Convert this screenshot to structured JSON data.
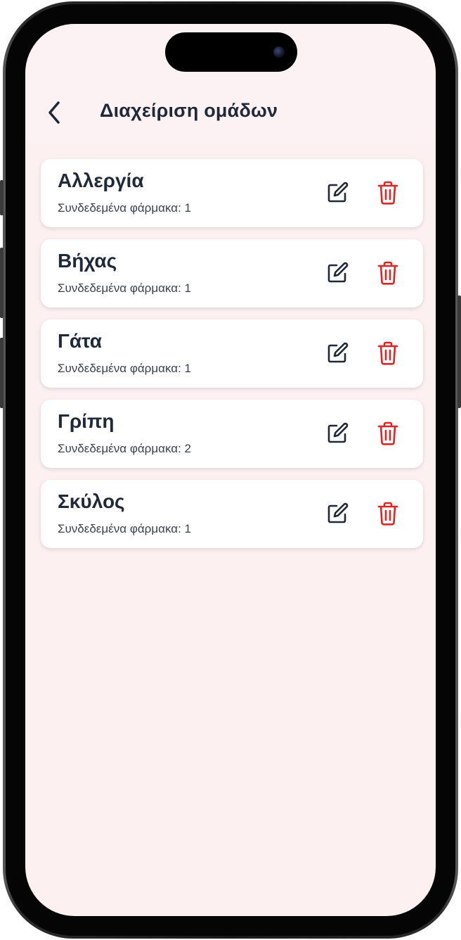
{
  "header": {
    "title": "Διαχείριση ομάδων",
    "back_icon": "chevron-left-icon"
  },
  "groups": [
    {
      "name": "Αλλεργία",
      "linked": "Συνδεδεμένα φάρμακα: 1"
    },
    {
      "name": "Βήχας",
      "linked": "Συνδεδεμένα φάρμακα: 1"
    },
    {
      "name": "Γάτα",
      "linked": "Συνδεδεμένα φάρμακα: 1"
    },
    {
      "name": "Γρίπη",
      "linked": "Συνδεδεμένα φάρμακα: 2"
    },
    {
      "name": "Σκύλος",
      "linked": "Συνδεδεμένα φάρμακα: 1"
    }
  ],
  "icons": {
    "edit": "edit-icon",
    "delete": "trash-icon"
  },
  "colors": {
    "background": "#fdf0f1",
    "text_primary": "#1f2937",
    "delete_red": "#dc2626",
    "card": "#ffffff"
  }
}
